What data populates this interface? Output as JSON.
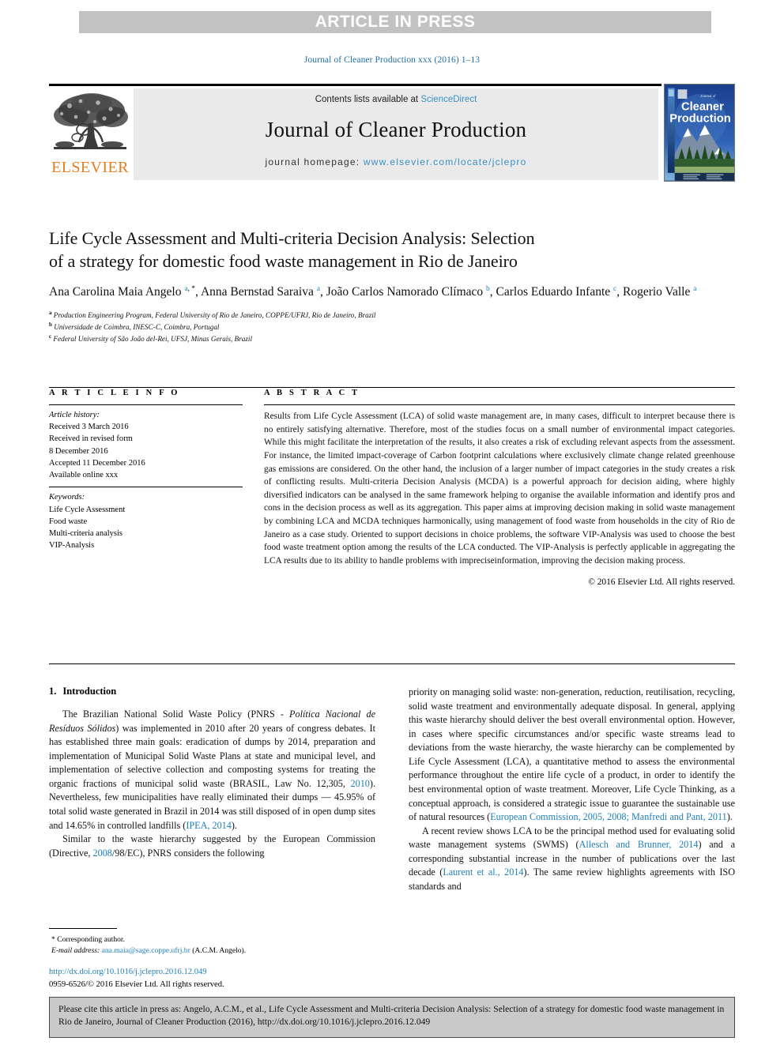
{
  "banner": {
    "label": "ARTICLE IN PRESS"
  },
  "running_head": "Journal of Cleaner Production xxx (2016) 1–13",
  "masthead": {
    "contents_prefix": "Contents lists available at ",
    "sciencedirect": "ScienceDirect",
    "journal_name": "Journal of Cleaner Production",
    "homepage_prefix": "journal homepage: ",
    "homepage_url": "www.elsevier.com/locate/jclepro",
    "publisher_logo_text": "ELSEVIER",
    "cover_title_small": "Journal of",
    "cover_title_line1": "Cleaner",
    "cover_title_line2": "Production"
  },
  "article": {
    "title_line1": "Life Cycle Assessment and Multi-criteria Decision Analysis: Selection",
    "title_line2": "of a strategy for domestic food waste management in Rio de Janeiro",
    "authors_html": "Ana Carolina Maia Angelo <sup>a</sup><sup class=\"star\">, *</sup>, Anna Bernstad Saraiva <sup>a</sup>, João Carlos Namorado Clímaco <sup>b</sup>, Carlos Eduardo Infante <sup>c</sup>, Rogerio Valle <sup>a</sup>",
    "affiliations": [
      {
        "marker": "a",
        "text": "Production Engineering Program, Federal University of Rio de Janeiro, COPPE/UFRJ, Rio de Janeiro, Brazil"
      },
      {
        "marker": "b",
        "text": "Universidade de Coimbra, INESC-C, Coimbra, Portugal"
      },
      {
        "marker": "c",
        "text": "Federal University of São João del-Rei, UFSJ, Minas Gerais, Brazil"
      }
    ]
  },
  "article_info": {
    "heading": "A R T I C L E  I N F O",
    "history_label": "Article history:",
    "history": [
      "Received 3 March 2016",
      "Received in revised form",
      "8 December 2016",
      "Accepted 11 December 2016",
      "Available online xxx"
    ],
    "keywords_label": "Keywords:",
    "keywords": [
      "Life Cycle Assessment",
      "Food waste",
      "Multi-criteria analysis",
      "VIP-Analysis"
    ]
  },
  "abstract": {
    "heading": "A B S T R A C T",
    "text": "Results from Life Cycle Assessment (LCA) of solid waste management are, in many cases, difficult to interpret because there is no entirely satisfying alternative. Therefore, most of the studies focus on a small number of environmental impact categories. While this might facilitate the interpretation of the results, it also creates a risk of excluding relevant aspects from the assessment. For instance, the limited impact-coverage of Carbon footprint calculations where exclusively climate change related greenhouse gas emissions are considered. On the other hand, the inclusion of a larger number of impact categories in the study creates a risk of conflicting results. Multi-criteria Decision Analysis (MCDA) is a powerful approach for decision aiding, where highly diversified indicators can be analysed in the same framework helping to organise the available information and identify pros and cons in the decision process as well as its aggregation. This paper aims at improving decision making in solid waste management by combining LCA and MCDA techniques harmonically, using management of food waste from households in the city of Rio de Janeiro as a case study. Oriented to support decisions in choice problems, the software VIP-Analysis was used to choose the best food waste treatment option among the results of the LCA conducted. The VIP-Analysis is perfectly applicable in aggregating the LCA results due to its ability to handle problems with impreciseinformation, improving the decision making process.",
    "copyright": "© 2016 Elsevier Ltd. All rights reserved."
  },
  "introduction": {
    "number": "1.",
    "heading": "Introduction",
    "left_paragraphs_html": [
      "The Brazilian National Solid Waste Policy (PNRS - <span class=\"it\">Política Nacional de Resíduos Sólidos</span>) was implemented in 2010 after 20 years of congress debates. It has established three main goals: eradication of dumps by 2014, preparation and implementation of Municipal Solid Waste Plans at state and municipal level, and implementation of selective collection and composting systems for treating the organic fractions of municipal solid waste (BRASIL, Law No. 12,305, <span class=\"ref\">2010</span>). Nevertheless, few municipalities have really eliminated their dumps — 45.95% of total solid waste generated in Brazil in 2014 was still disposed of in open dump sites and 14.65% in controlled landfills (<span class=\"ref\">IPEA, 2014</span>).",
      "Similar to the waste hierarchy suggested by the European Commission (Directive, <span class=\"ref\">2008</span>/98/EC), PNRS considers the following"
    ],
    "right_paragraphs_html": [
      "priority on managing solid waste: non-generation, reduction, reutilisation, recycling, solid waste treatment and environmentally adequate disposal. In general, applying this waste hierarchy should deliver the best overall environmental option. However, in cases where specific circumstances and/or specific waste streams lead to deviations from the waste hierarchy, the waste hierarchy can be complemented by Life Cycle Assessment (LCA), a quantitative method to assess the environmental performance throughout the entire life cycle of a product, in order to identify the best environmental option of waste treatment. Moreover, Life Cycle Thinking, as a conceptual approach, is considered a strategic issue to guarantee the sustainable use of natural resources (<span class=\"ref\">European Commission, 2005, 2008; Manfredi and Pant, 2011</span>).",
      "A recent review shows LCA to be the principal method used for evaluating solid waste management systems (SWMS) (<span class=\"ref\">Allesch and Brunner, 2014</span>) and a corresponding substantial increase in the number of publications over the last decade (<span class=\"ref\">Laurent et al., 2014</span>). The same review highlights agreements with ISO standards and"
    ]
  },
  "footnote": {
    "corresponding": "* Corresponding author.",
    "email_label": "E-mail address:",
    "email": "ana.maia@sage.coppe.ufrj.br",
    "email_suffix": "(A.C.M. Angelo)."
  },
  "footer": {
    "doi": "http://dx.doi.org/10.1016/j.jclepro.2016.12.049",
    "issn_copyright": "0959-6526/© 2016 Elsevier Ltd. All rights reserved."
  },
  "cite_box": {
    "text": "Please cite this article in press as: Angelo, A.C.M., et al., Life Cycle Assessment and Multi-criteria Decision Analysis: Selection of a strategy for domestic food waste management in Rio de Janeiro, Journal of Cleaner Production (2016), http://dx.doi.org/10.1016/j.jclepro.2016.12.049"
  },
  "colors": {
    "link_blue": "#1e7fb8",
    "banner_gray": "#c2c2c2",
    "masthead_gray": "#eaeaea",
    "cite_gray": "#c9c9c9",
    "elsevier_orange": "#e87c1e"
  }
}
